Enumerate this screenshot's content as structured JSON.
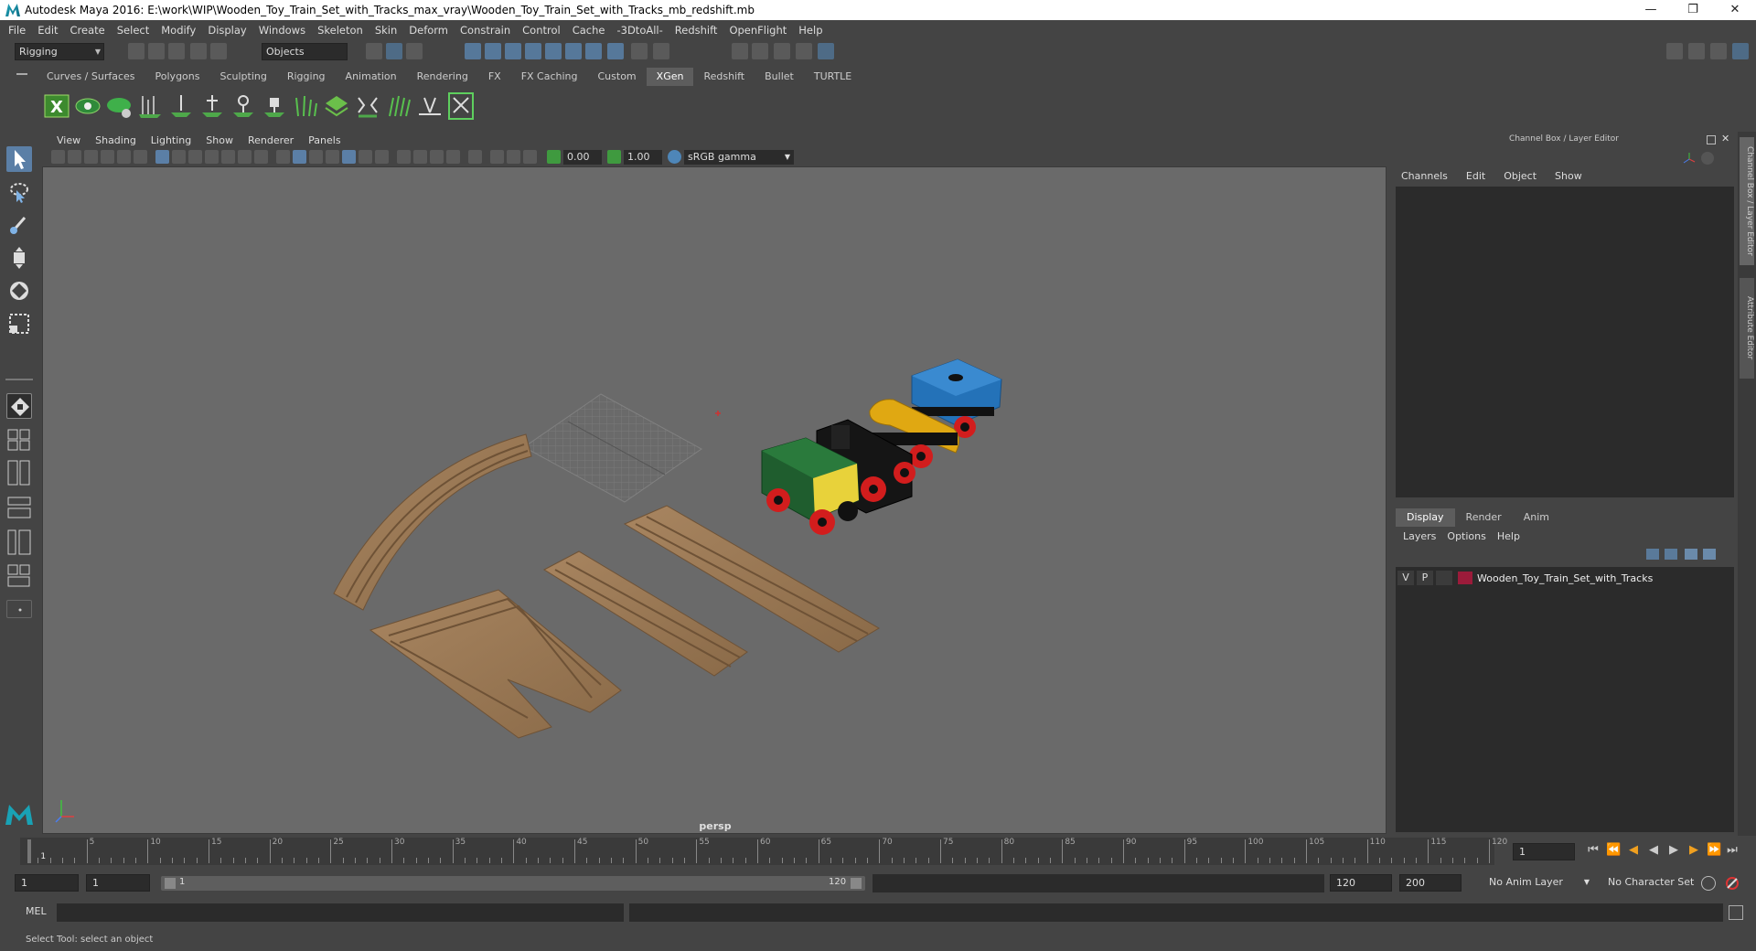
{
  "window": {
    "title": "Autodesk Maya 2016: E:\\work\\WIP\\Wooden_Toy_Train_Set_with_Tracks_max_vray\\Wooden_Toy_Train_Set_with_Tracks_mb_redshift.mb",
    "controls": {
      "minimize": "—",
      "restore": "❐",
      "close": "✕"
    }
  },
  "menubar": [
    "File",
    "Edit",
    "Create",
    "Select",
    "Modify",
    "Display",
    "Windows",
    "Skeleton",
    "Skin",
    "Deform",
    "Constrain",
    "Control",
    "Cache",
    "-3DtoAll-",
    "Redshift",
    "OpenFlight",
    "Help"
  ],
  "statusline": {
    "mode": "Rigging",
    "selection_mask": "Objects"
  },
  "shelf": {
    "tabs": [
      "Curves / Surfaces",
      "Polygons",
      "Sculpting",
      "Rigging",
      "Animation",
      "Rendering",
      "FX",
      "FX Caching",
      "Custom",
      "XGen",
      "Redshift",
      "Bullet",
      "TURTLE"
    ],
    "active_tab": "XGen"
  },
  "viewport": {
    "menu": [
      "View",
      "Shading",
      "Lighting",
      "Show",
      "Renderer",
      "Panels"
    ],
    "exposure": "0.00",
    "gamma": "1.00",
    "color_space": "sRGB gamma",
    "camera_label": "persp"
  },
  "channel_box": {
    "title": "Channel Box / Layer Editor",
    "menu": [
      "Channels",
      "Edit",
      "Object",
      "Show"
    ]
  },
  "layer_editor": {
    "tabs": [
      "Display",
      "Render",
      "Anim"
    ],
    "active_tab": "Display",
    "menu": [
      "Layers",
      "Options",
      "Help"
    ],
    "layers": [
      {
        "v": "V",
        "p": "P",
        "name": "Wooden_Toy_Train_Set_with_Tracks",
        "color": "#9b1b3a"
      }
    ]
  },
  "side_tabs": [
    "Channel Box / Layer Editor",
    "Attribute Editor"
  ],
  "timeslider": {
    "labels": [
      "1",
      "5",
      "10",
      "15",
      "20",
      "25",
      "30",
      "35",
      "40",
      "45",
      "50",
      "55",
      "60",
      "65",
      "70",
      "75",
      "80",
      "85",
      "90",
      "95",
      "100",
      "105",
      "110",
      "115",
      "120"
    ],
    "current_frame": "1"
  },
  "range": {
    "start": "1",
    "playback_start": "1",
    "range_start_label": "1",
    "range_end_label": "120",
    "playback_end": "120",
    "end": "200",
    "anim_layer": "No Anim Layer",
    "character_set": "No Character Set"
  },
  "commandline": {
    "label": "MEL"
  },
  "helpline": {
    "text": "Select Tool: select an object"
  }
}
